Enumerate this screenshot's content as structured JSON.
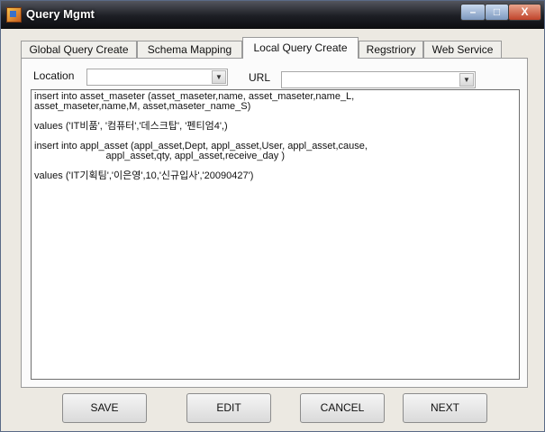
{
  "window": {
    "title": "Query Mgmt",
    "controls": {
      "minimize": "–",
      "maximize": "□",
      "close": "X"
    }
  },
  "tabs": [
    {
      "label": "Global Query Create",
      "active": false
    },
    {
      "label": "Schema Mapping",
      "active": false
    },
    {
      "label": "Local Query Create",
      "active": true
    },
    {
      "label": "Regstriory",
      "active": false
    },
    {
      "label": "Web Service",
      "active": false
    }
  ],
  "form": {
    "location_label": "Location",
    "location_value": "",
    "url_label": "URL",
    "url_value": ""
  },
  "query_text": "insert into asset_maseter (asset_maseter,name, asset_maseter,name_L,\nasset_maseter,name,M, asset,maseter_name_S)\n\nvalues ('IT비품', '컴퓨터','데스크탑', '펜티엄4',)\n\ninsert into appl_asset (appl_asset,Dept, appl_asset,User, appl_asset,cause,\n                          appl_asset,qty, appl_asset,receive_day )\n\nvalues ('IT기획팀','이은영',10,'신규입사','20090427')",
  "buttons": {
    "save": "SAVE",
    "edit": "EDIT",
    "cancel": "CANCEL",
    "next": "NEXT"
  },
  "icons": {
    "app": "app-icon",
    "dropdown": "chevron-down-icon"
  }
}
